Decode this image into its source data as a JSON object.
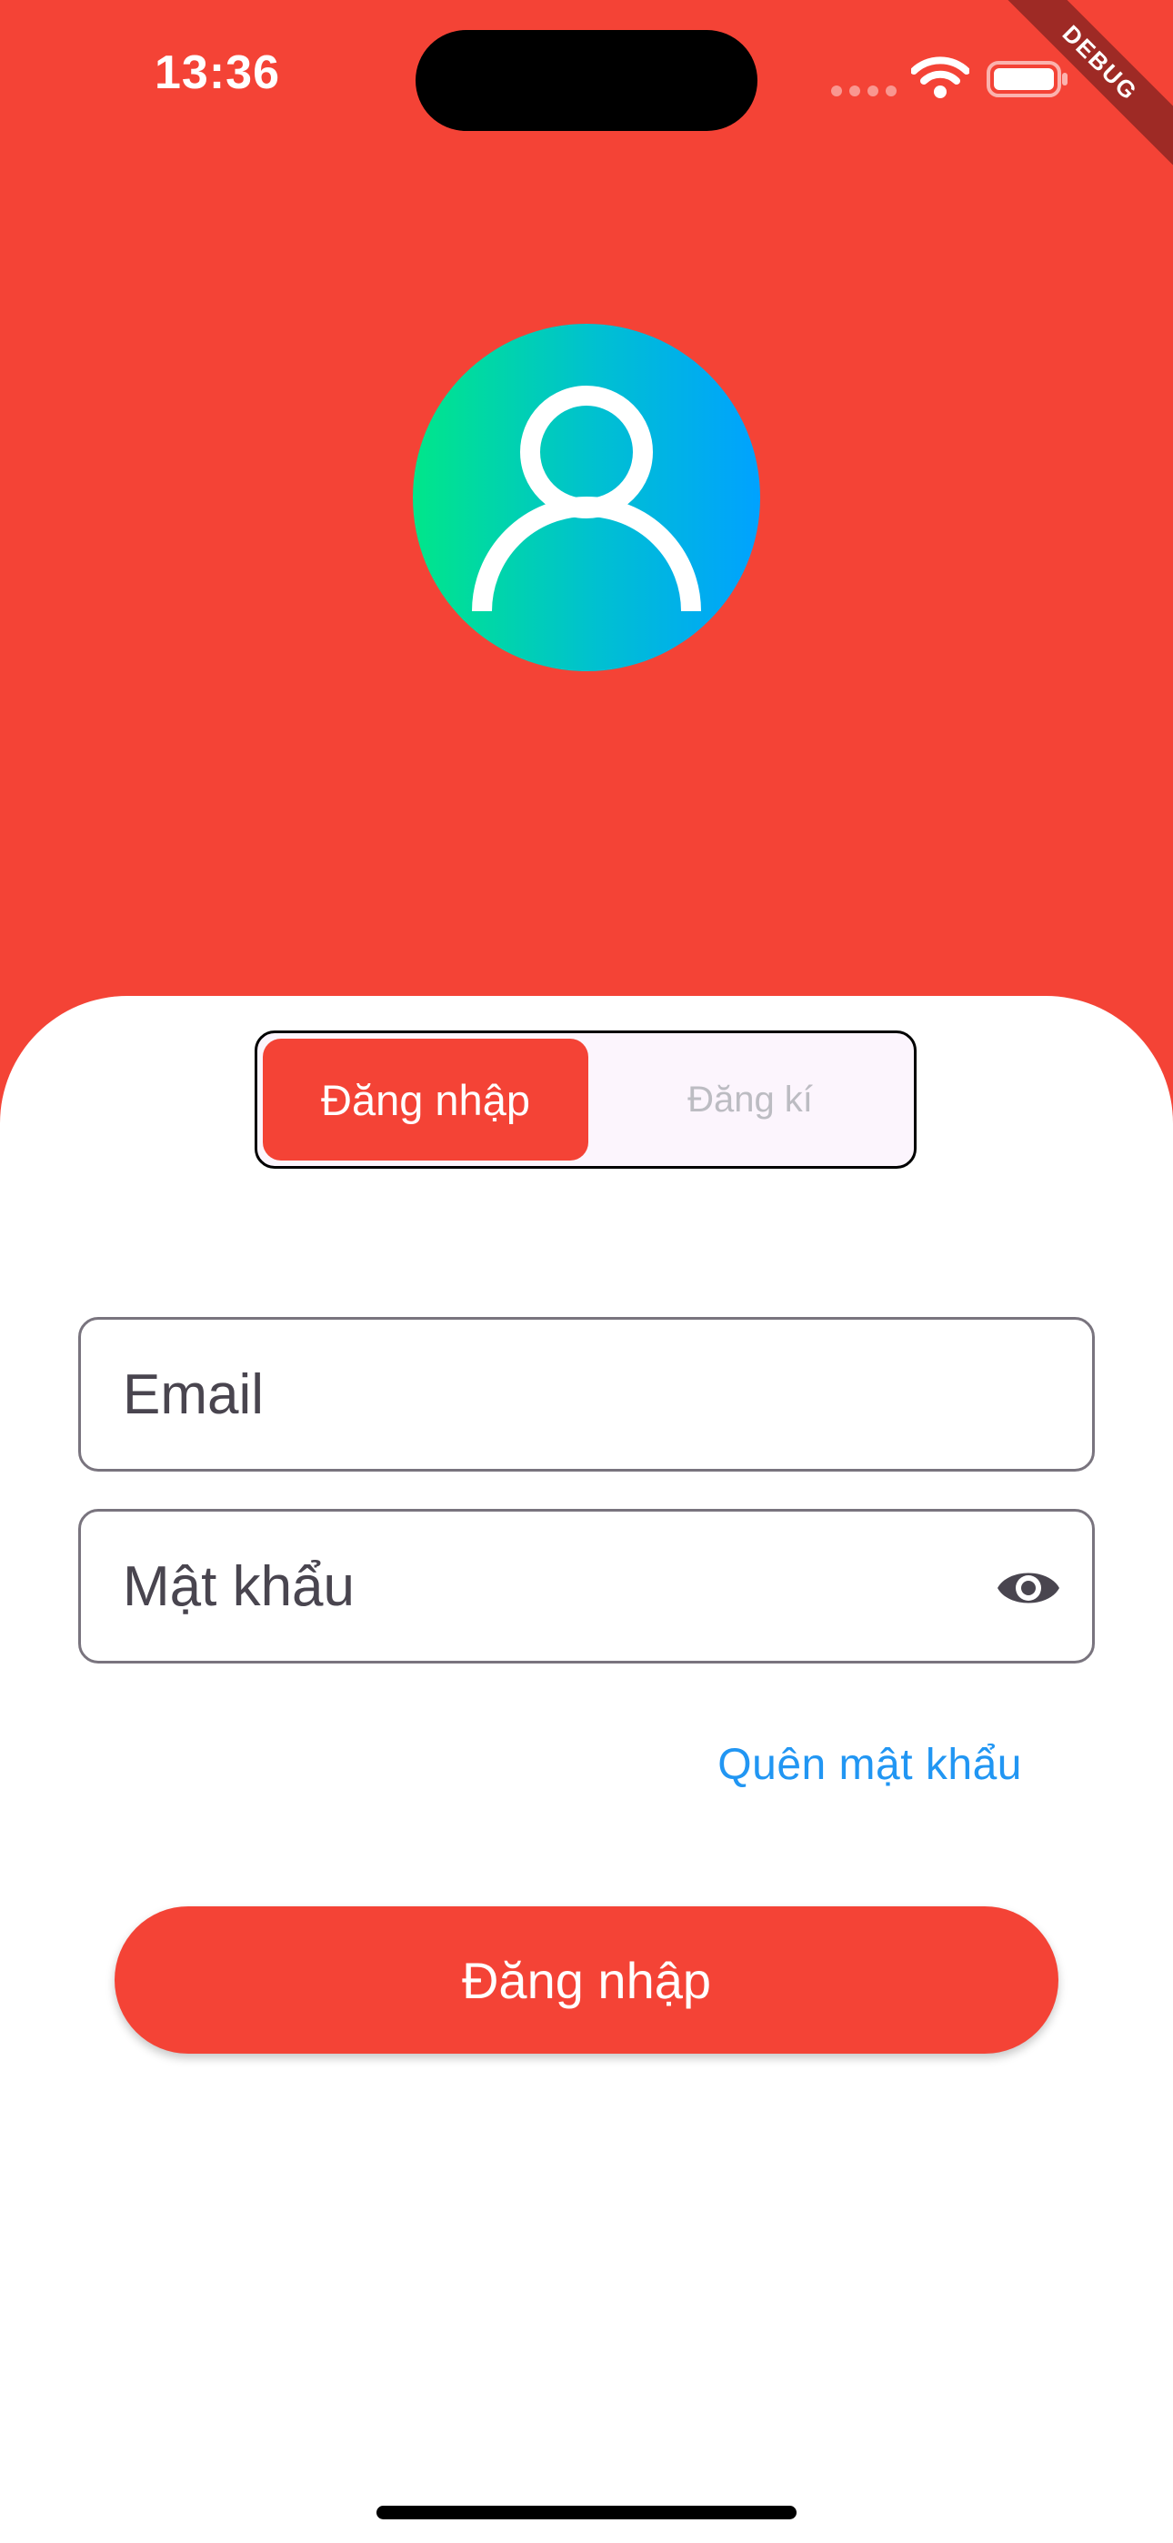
{
  "status_bar": {
    "time": "13:36"
  },
  "debug_banner": "DEBUG",
  "avatar": {
    "icon": "person-outline-icon",
    "gradient": [
      "#00E68A",
      "#00A2FF"
    ]
  },
  "auth_toggle": {
    "login_label": "Đăng nhập",
    "register_label": "Đăng kí",
    "selected": "login"
  },
  "form": {
    "email": {
      "placeholder": "Email",
      "value": ""
    },
    "password": {
      "placeholder": "Mật khẩu",
      "value": "",
      "toggle_icon": "eye-icon"
    },
    "forgot_password": "Quên mật khẩu",
    "submit_label": "Đăng nhập"
  },
  "colors": {
    "primary": "#F44336",
    "link": "#2196F3",
    "field_border": "#79747E"
  }
}
